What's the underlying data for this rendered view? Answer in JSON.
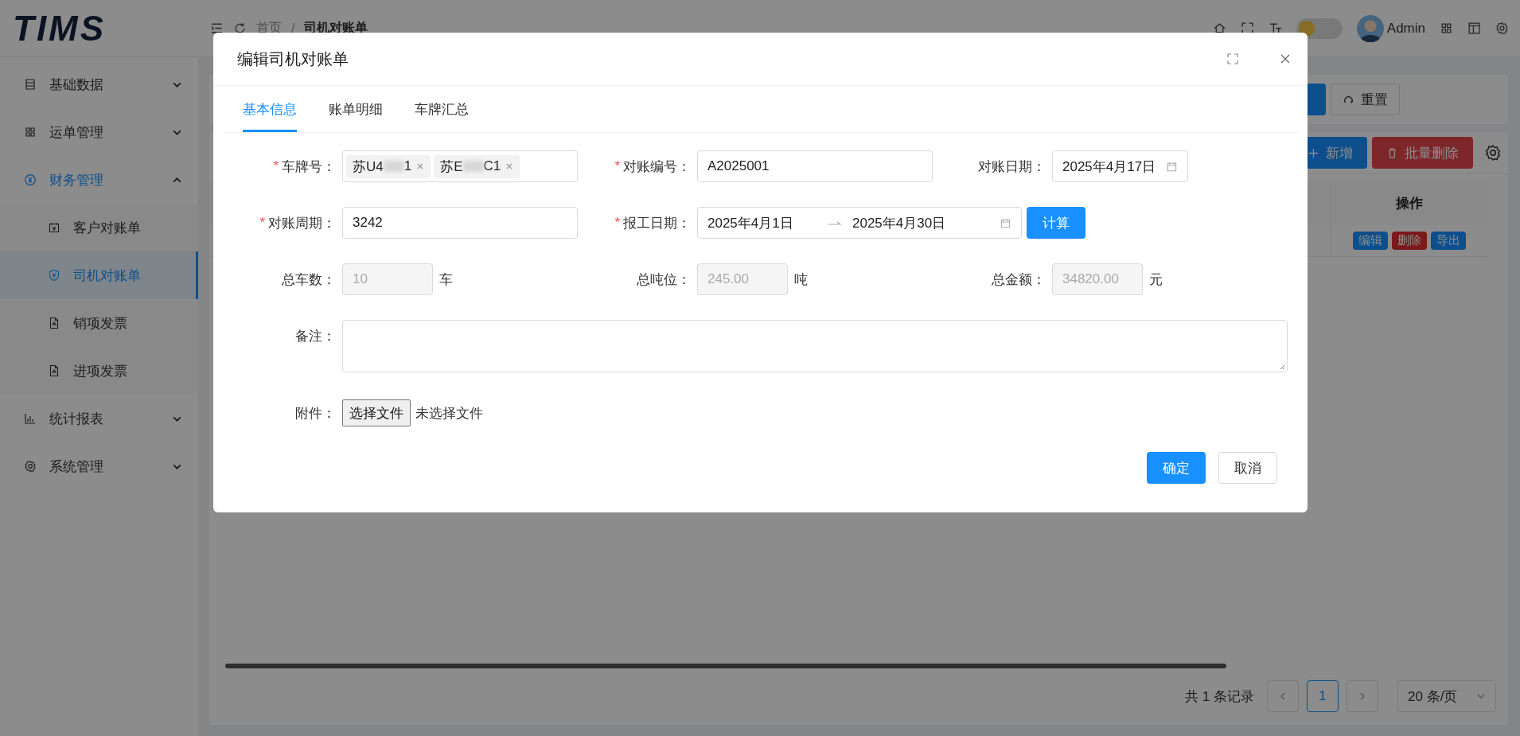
{
  "header": {
    "logo": "TIMS",
    "breadcrumb": [
      {
        "label": "首页",
        "current": false
      },
      {
        "label": "司机对账单",
        "current": true
      }
    ],
    "separator": "/",
    "theme_switch": {
      "on": false
    },
    "user": "Admin"
  },
  "sidebar": {
    "items": [
      {
        "label": "基础数据",
        "expanded": false,
        "selected": false
      },
      {
        "label": "运单管理",
        "expanded": false,
        "selected": false
      },
      {
        "label": "财务管理",
        "expanded": true,
        "selected": true,
        "children": [
          {
            "label": "客户对账单",
            "selected": false
          },
          {
            "label": "司机对账单",
            "selected": true
          },
          {
            "label": "销项发票",
            "selected": false
          },
          {
            "label": "进项发票",
            "selected": false
          }
        ]
      },
      {
        "label": "统计报表",
        "expanded": false,
        "selected": false
      },
      {
        "label": "系统管理",
        "expanded": false,
        "selected": false
      }
    ]
  },
  "filter": {
    "reset_button": "重置"
  },
  "table": {
    "toolbar": [
      {
        "label": "新增",
        "kind": "add"
      },
      {
        "label": "批量删除",
        "kind": "delete"
      }
    ],
    "action_column": "操作",
    "row_actions": [
      {
        "label": "编辑",
        "kind": "edit"
      },
      {
        "label": "删除",
        "kind": "delete"
      },
      {
        "label": "导出",
        "kind": "export"
      }
    ]
  },
  "pagination": {
    "total": "共 1 条记录",
    "pages": [
      {
        "label": "1",
        "selected": true
      }
    ],
    "page_size": "20 条/页"
  },
  "dialog": {
    "title": "编辑司机对账单",
    "required_mark": "*",
    "tabs": [
      {
        "label": "基本信息",
        "selected": true
      },
      {
        "label": "账单明细",
        "selected": false
      },
      {
        "label": "车牌汇总",
        "selected": false
      }
    ],
    "rows": [
      [
        {
          "kind": "tags",
          "label": "车牌号：",
          "required": true,
          "tags": [
            {
              "prefix": "苏U4",
              "suffix": "1"
            },
            {
              "prefix": "苏E",
              "suffix": "C1"
            }
          ]
        },
        {
          "kind": "text",
          "label": "对账编号：",
          "required": true,
          "value": "A2025001",
          "disabled": false
        },
        {
          "kind": "date",
          "label": "对账日期：",
          "required": false,
          "value": "2025年4月17日"
        }
      ],
      [
        {
          "kind": "text",
          "label": "对账周期：",
          "required": true,
          "value": "3242",
          "disabled": false
        },
        {
          "kind": "range",
          "label": "报工日期：",
          "required": true,
          "start": "2025年4月1日",
          "end": "2025年4月30日",
          "button": "计算"
        }
      ],
      [
        {
          "kind": "text",
          "label": "总车数：",
          "required": false,
          "value": "10",
          "disabled": true,
          "unit": "车"
        },
        {
          "kind": "text",
          "label": "总吨位：",
          "required": false,
          "value": "245.00",
          "disabled": true,
          "unit": "吨"
        },
        {
          "kind": "text",
          "label": "总金额：",
          "required": false,
          "value": "34820.00",
          "disabled": true,
          "unit": "元"
        }
      ],
      [
        {
          "kind": "textarea",
          "label": "备注：",
          "required": false
        }
      ],
      [
        {
          "kind": "file",
          "label": "附件：",
          "required": false,
          "button": "选择文件",
          "status": "未选择文件"
        }
      ]
    ],
    "buttons": [
      {
        "label": "确定",
        "kind": "primary"
      },
      {
        "label": "取消",
        "kind": "default"
      }
    ]
  }
}
